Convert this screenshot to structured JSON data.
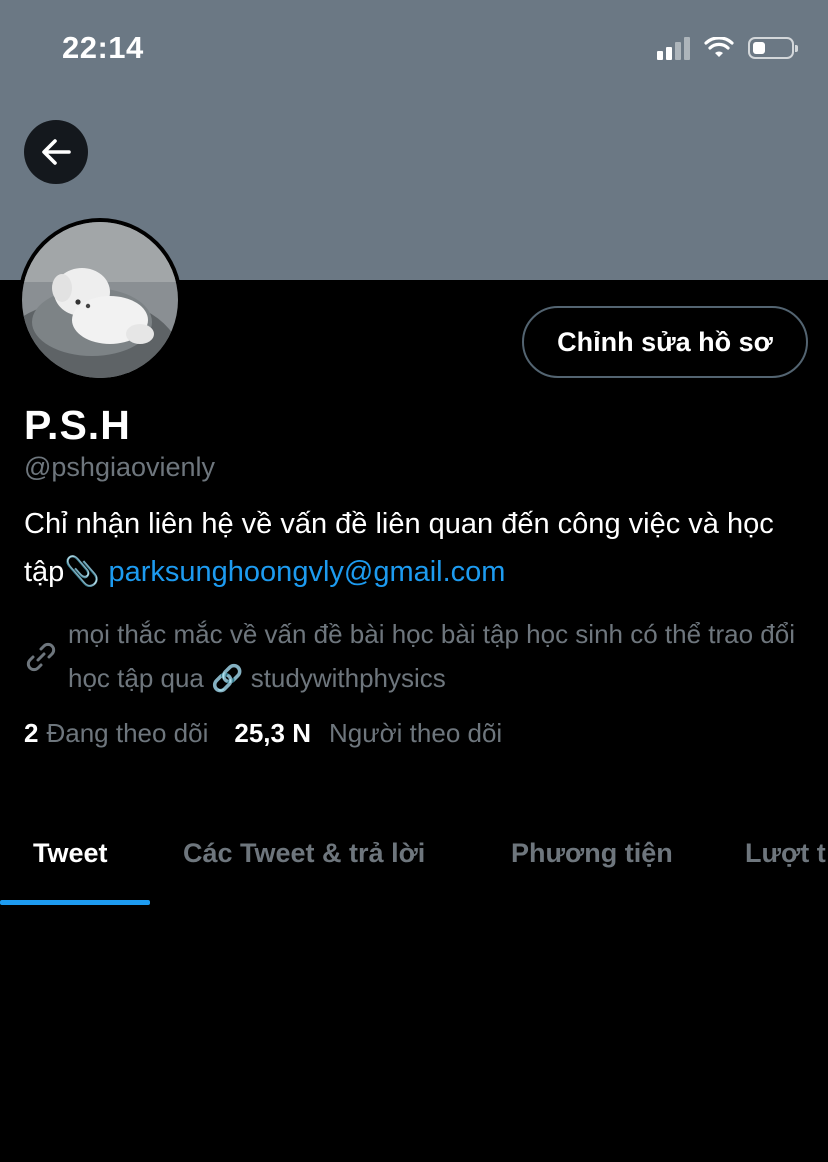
{
  "status_bar": {
    "time": "22:14"
  },
  "profile": {
    "name": "P.S.H",
    "handle": "@pshgiaovienly",
    "bio_text": "Chỉ nhận liên hệ về vấn đề liên quan đến công việc và học tập📎",
    "bio_email": "parksunghoongvly@gmail.com",
    "link_text": "mọi thắc mắc về vấn đề bài học bài tập học sinh có thể trao đổi học tập qua 🔗 studywithphysics",
    "following_count": "2",
    "following_label": "Đang theo dõi",
    "followers_count": "25,3 N",
    "followers_label": "Người theo dõi",
    "edit_button_label": "Chỉnh sửa hồ sơ"
  },
  "tabs": [
    {
      "label": "Tweet",
      "active": true
    },
    {
      "label": "Các Tweet & trả lời",
      "active": false
    },
    {
      "label": "Phương tiện",
      "active": false
    },
    {
      "label": "Lượt t",
      "active": false
    }
  ],
  "colors": {
    "banner": "#6b7884",
    "accent": "#1d9bf0",
    "secondary_text": "#6e767d"
  },
  "icons": [
    "back-arrow-icon",
    "link-icon",
    "signal-icon",
    "wifi-icon",
    "battery-icon"
  ]
}
